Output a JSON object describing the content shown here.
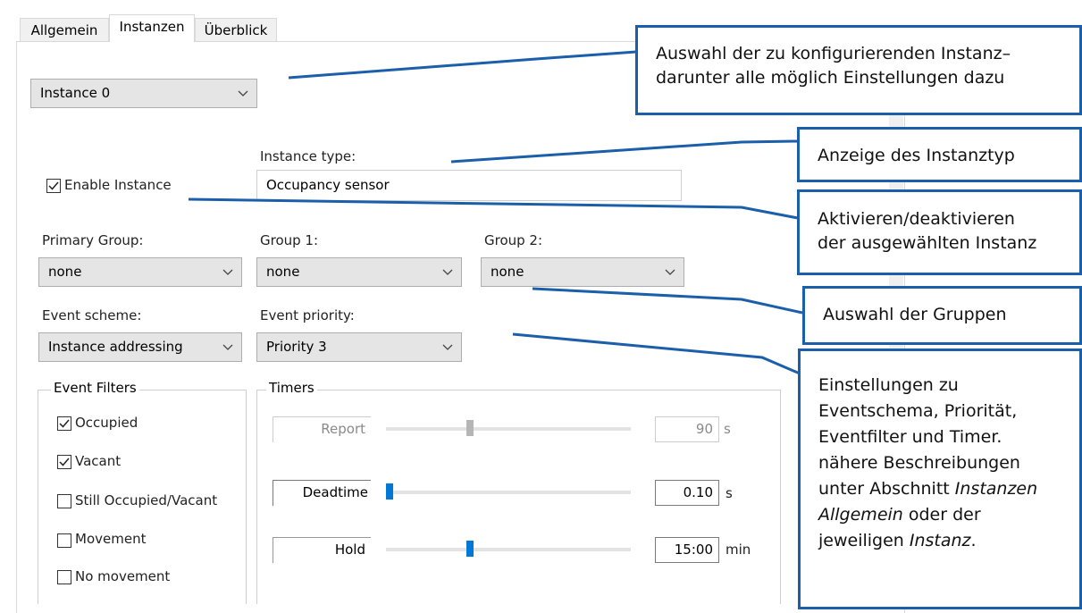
{
  "tabs": [
    {
      "label": "Allgemein"
    },
    {
      "label": "Instanzen"
    },
    {
      "label": "Überblick"
    }
  ],
  "instance_select": {
    "value": "Instance 0"
  },
  "instance_type": {
    "label": "Instance type:",
    "value": "Occupancy sensor"
  },
  "enable_instance": {
    "label": "Enable Instance",
    "checked": true
  },
  "primary_group": {
    "label": "Primary Group:",
    "value": "none"
  },
  "group1": {
    "label": "Group 1:",
    "value": "none"
  },
  "group2": {
    "label": "Group 2:",
    "value": "none"
  },
  "event_scheme": {
    "label": "Event scheme:",
    "value": "Instance addressing"
  },
  "event_priority": {
    "label": "Event priority:",
    "value": "Priority 3"
  },
  "event_filters": {
    "title": "Event Filters",
    "items": [
      {
        "label": "Occupied",
        "checked": true
      },
      {
        "label": "Vacant",
        "checked": true
      },
      {
        "label": "Still Occupied/Vacant",
        "checked": false
      },
      {
        "label": "Movement",
        "checked": false
      },
      {
        "label": "No movement",
        "checked": false
      }
    ]
  },
  "timers": {
    "title": "Timers",
    "rows": [
      {
        "label": "Report",
        "value": "90",
        "unit": "s",
        "enabled": false,
        "level": 0.34
      },
      {
        "label": "Deadtime",
        "value": "0.10",
        "unit": "s",
        "enabled": true,
        "level": 0.0
      },
      {
        "label": "Hold",
        "value": "15:00",
        "unit": "min",
        "enabled": true,
        "level": 0.34
      }
    ]
  },
  "callouts": {
    "auswahl": [
      "Auswahl der zu konfigurierenden Instanz–",
      "darunter alle möglich Einstellungen dazu"
    ],
    "anzeige": [
      "Anzeige des Instanztyp"
    ],
    "aktivieren": [
      "Aktivieren/deaktivieren",
      "der ausgewählten Instanz"
    ],
    "gruppen": [
      "Auswahl der Gruppen"
    ],
    "einstellungen": [
      "Einstellungen zu",
      "Eventschema, Priorität,",
      "Eventfilter und Timer.",
      "nähere Beschreibungen",
      "unter Abschnitt ",
      "Allgemein",
      " oder der",
      "jeweiligen ",
      "Instanz",
      "."
    ],
    "einstellungen_italic_instanzen": "Instanzen"
  },
  "colors": {
    "callout_border": "#1b5faa",
    "slider_thumb": "#0078d7",
    "slider_thumb_disabled": "#b5b5b5"
  }
}
